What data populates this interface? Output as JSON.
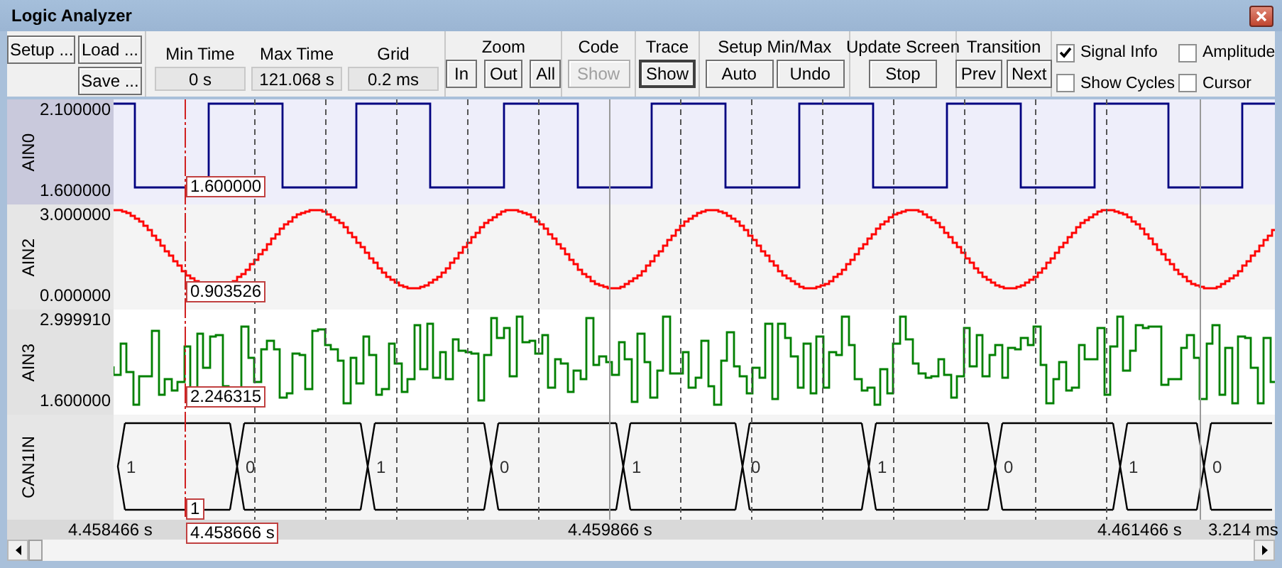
{
  "window": {
    "title": "Logic Analyzer"
  },
  "toolbar": {
    "file_buttons": [
      {
        "label": "Setup ..."
      },
      {
        "label": "Load ..."
      },
      {
        "label": "Save ..."
      }
    ],
    "time_fields": [
      {
        "label": "Min Time",
        "value": "0 s"
      },
      {
        "label": "Max Time",
        "value": "121.068 s"
      },
      {
        "label": "Grid",
        "value": "0.2 ms"
      }
    ],
    "groups": [
      {
        "title": "Zoom",
        "buttons": [
          {
            "label": "In",
            "disabled": false,
            "focused": false
          },
          {
            "label": "Out",
            "disabled": false,
            "focused": false
          },
          {
            "label": "All",
            "disabled": false,
            "focused": false
          }
        ]
      },
      {
        "title": "Code",
        "buttons": [
          {
            "label": "Show",
            "disabled": true,
            "focused": false
          }
        ]
      },
      {
        "title": "Trace",
        "buttons": [
          {
            "label": "Show",
            "disabled": false,
            "focused": true
          }
        ]
      },
      {
        "title": "Setup Min/Max",
        "buttons": [
          {
            "label": "Auto",
            "disabled": false,
            "focused": false
          },
          {
            "label": "Undo",
            "disabled": false,
            "focused": false
          }
        ]
      },
      {
        "title": "Update Screen",
        "buttons": [
          {
            "label": "Stop",
            "disabled": false,
            "focused": false
          }
        ]
      },
      {
        "title": "Transition",
        "buttons": [
          {
            "label": "Prev",
            "disabled": false,
            "focused": false
          },
          {
            "label": "Next",
            "disabled": false,
            "focused": false
          }
        ]
      }
    ],
    "options": [
      {
        "label": "Signal Info",
        "checked": true
      },
      {
        "label": "Amplitude",
        "checked": false
      },
      {
        "label": "Show Cycles",
        "checked": false
      },
      {
        "label": "Cursor",
        "checked": false
      }
    ]
  },
  "signals": [
    {
      "name": "AIN0",
      "kind": "square",
      "color": "#000080",
      "max": "2.100000",
      "min": "1.600000",
      "cursor_value": "1.600000"
    },
    {
      "name": "AIN2",
      "kind": "sine",
      "color": "#ff0000",
      "max": "3.000000",
      "min": "0.000000",
      "cursor_value": "0.903526"
    },
    {
      "name": "AIN3",
      "kind": "noise",
      "color": "#008000",
      "max": "2.999910",
      "min": "1.600000",
      "cursor_value": "2.246315"
    },
    {
      "name": "CAN1IN",
      "kind": "bits",
      "color": "#000000",
      "bits": [
        "1",
        "0",
        "1",
        "0",
        "1",
        "0",
        "1",
        "0",
        "1",
        "0"
      ],
      "cursor_value": "1"
    }
  ],
  "time_axis": {
    "labels": [
      "4.458466 s",
      "4.459866 s",
      "4.461466 s"
    ],
    "cursor_time": "4.458666 s",
    "span": "3.214 ms"
  }
}
